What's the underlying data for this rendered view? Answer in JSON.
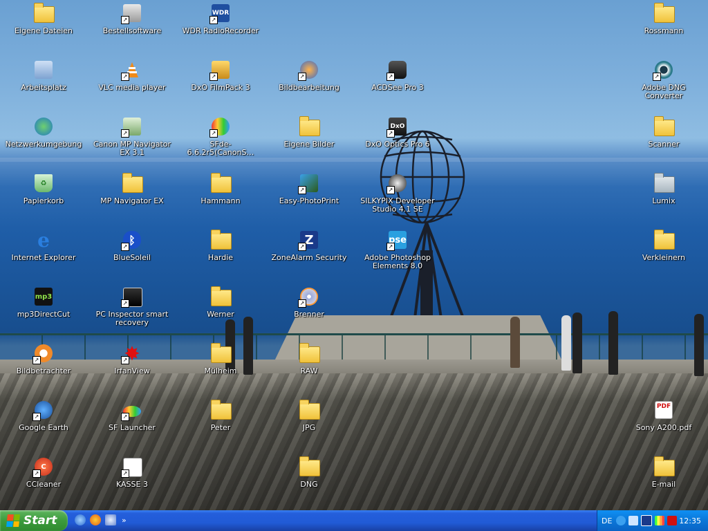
{
  "desktop": {
    "icons": [
      {
        "label": "Eigene Dateien",
        "type": "folder"
      },
      {
        "label": "Bestellsoftware",
        "type": "app"
      },
      {
        "label": "WDR RadioRecorder",
        "type": "app"
      },
      {
        "label": "Rossmann",
        "type": "folder"
      },
      {
        "label": "Arbeitsplatz",
        "type": "app"
      },
      {
        "label": "VLC media player",
        "type": "app"
      },
      {
        "label": "DxO FilmPack 3",
        "type": "app"
      },
      {
        "label": "Bildbearbeitung",
        "type": "app"
      },
      {
        "label": "ACDSee Pro 3",
        "type": "app"
      },
      {
        "label": "Adobe DNG Converter",
        "type": "app"
      },
      {
        "label": "Netzwerkumgebung",
        "type": "app"
      },
      {
        "label": "Canon MP Navigator EX 3.1",
        "type": "app"
      },
      {
        "label": "SFde-6.6.2r5(CanonS…",
        "type": "app"
      },
      {
        "label": "Eigene Bilder",
        "type": "folder"
      },
      {
        "label": "DxO Optics Pro 6",
        "type": "app"
      },
      {
        "label": "Scanner",
        "type": "folder"
      },
      {
        "label": "Papierkorb",
        "type": "app"
      },
      {
        "label": "MP Navigator EX",
        "type": "folder"
      },
      {
        "label": "Hammann",
        "type": "folder"
      },
      {
        "label": "Easy-PhotoPrint",
        "type": "app"
      },
      {
        "label": "SILKYPIX Developer Studio 4.1 SE",
        "type": "app"
      },
      {
        "label": "Lumix",
        "type": "folder"
      },
      {
        "label": "Internet Explorer",
        "type": "app"
      },
      {
        "label": "BlueSoleil",
        "type": "app"
      },
      {
        "label": "Hardie",
        "type": "folder"
      },
      {
        "label": "ZoneAlarm Security",
        "type": "app"
      },
      {
        "label": "Adobe Photoshop Elements 8.0",
        "type": "app"
      },
      {
        "label": "Verkleinern",
        "type": "folder"
      },
      {
        "label": "mp3DirectCut",
        "type": "app"
      },
      {
        "label": "PC Inspector smart recovery",
        "type": "app"
      },
      {
        "label": "Werner",
        "type": "folder"
      },
      {
        "label": "Brenner",
        "type": "app"
      },
      {
        "label": "Bildbetrachter",
        "type": "app"
      },
      {
        "label": "IrfanView",
        "type": "app"
      },
      {
        "label": "Mülheim",
        "type": "folder"
      },
      {
        "label": "RAW",
        "type": "folder"
      },
      {
        "label": "Google Earth",
        "type": "app"
      },
      {
        "label": "SF Launcher",
        "type": "app"
      },
      {
        "label": "Peter",
        "type": "folder"
      },
      {
        "label": "JPG",
        "type": "folder"
      },
      {
        "label": "Sony A200.pdf",
        "type": "file"
      },
      {
        "label": "CCleaner",
        "type": "app"
      },
      {
        "label": "KASSE 3",
        "type": "app"
      },
      {
        "label": "DNG",
        "type": "folder"
      },
      {
        "label": "E-mail",
        "type": "folder"
      }
    ],
    "badges": {
      "wdr": "WDR",
      "zone": "Z",
      "pse": "pse",
      "mp3": "mp3",
      "dxo": "DxO",
      "pdf": "PDF"
    }
  },
  "taskbar": {
    "start_label": "Start",
    "quick_launch_more": "»",
    "language": "DE",
    "clock": "12:35"
  },
  "colors": {
    "taskbar": "#245edb",
    "start": "#3c9b3c",
    "tray": "#0b77d8"
  }
}
